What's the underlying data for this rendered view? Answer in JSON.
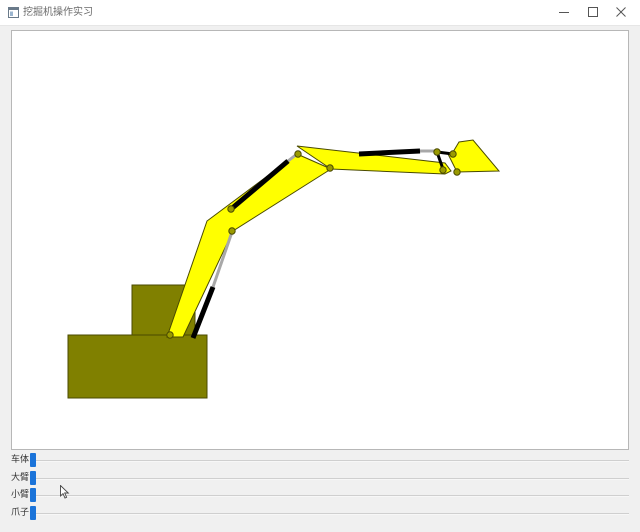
{
  "window": {
    "title": "挖掘机操作实习",
    "icon": "app-window-icon",
    "controls": [
      "minimize-icon",
      "maximize-icon",
      "close-icon"
    ]
  },
  "scene": {
    "colors": {
      "body": "#808000",
      "arm": "#ffff00",
      "outline": "#4a4a00",
      "cylinder_barrel": "#000000",
      "cylinder_rod": "#a8a8a8",
      "pivot": "#9a9a00"
    }
  },
  "controls": [
    {
      "label": "车体",
      "value": 0,
      "accent": "#1a73d9"
    },
    {
      "label": "大臂",
      "value": 0,
      "accent": "#1a73d9"
    },
    {
      "label": "小臂",
      "value": 0,
      "accent": "#1a73d9"
    },
    {
      "label": "爪子",
      "value": 0,
      "accent": "#1a73d9"
    }
  ]
}
